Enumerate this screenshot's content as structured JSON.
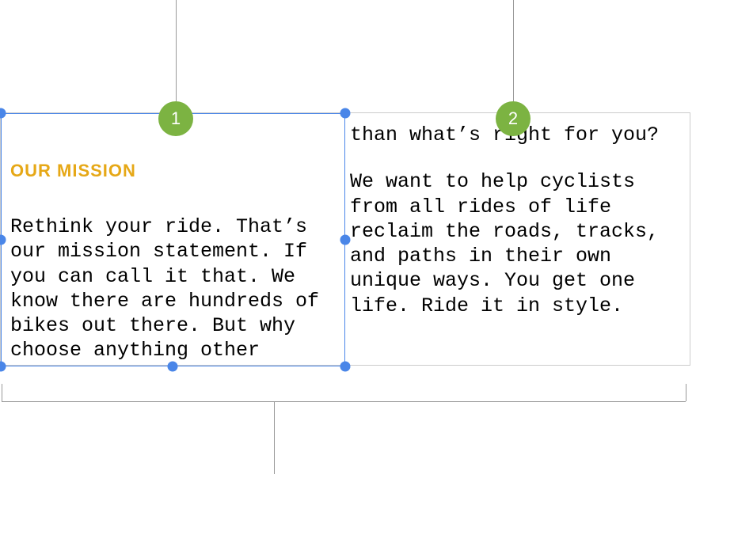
{
  "callouts": {
    "label1": "1",
    "label2": "2"
  },
  "content": {
    "heading": "OUR MISSION",
    "col1_body": "Rethink your ride. That’s our mission statement. If you can call it that. We know there are hundreds of bikes out there. But why choose anything other",
    "col2_body_a": "than what’s right for you?",
    "col2_body_b": "We want to help cyclists from all rides of life reclaim the roads, tracks, and paths in their own unique ways. You get one life. Ride it in style."
  },
  "colors": {
    "badge": "#7cb342",
    "heading": "#e6a817",
    "selection": "#4a86e8"
  }
}
